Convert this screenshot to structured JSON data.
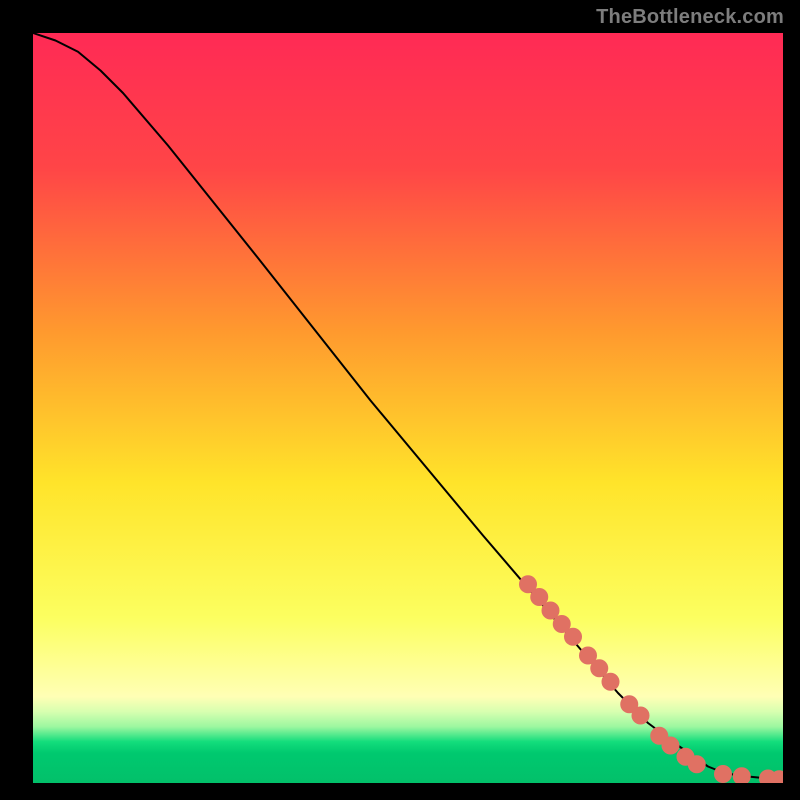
{
  "watermark": "TheBottleneck.com",
  "chart_data": {
    "type": "line",
    "title": "",
    "xlabel": "",
    "ylabel": "",
    "xlim": [
      0,
      100
    ],
    "ylim": [
      0,
      100
    ],
    "grid": false,
    "background_gradient": {
      "stops": [
        {
          "y": 0,
          "color": "#ff2a55"
        },
        {
          "y": 0.18,
          "color": "#ff4547"
        },
        {
          "y": 0.4,
          "color": "#ff9a2e"
        },
        {
          "y": 0.6,
          "color": "#ffe42a"
        },
        {
          "y": 0.78,
          "color": "#fcff60"
        },
        {
          "y": 0.885,
          "color": "#ffffb5"
        },
        {
          "y": 0.905,
          "color": "#d7ffb0"
        },
        {
          "y": 0.925,
          "color": "#9cf7a0"
        },
        {
          "y": 0.945,
          "color": "#13dd7c"
        },
        {
          "y": 0.96,
          "color": "#00c96f"
        },
        {
          "y": 1.0,
          "color": "#02c06a"
        }
      ]
    },
    "series": [
      {
        "name": "bottleneck-curve",
        "color": "#000000",
        "stroke_width": 2,
        "x": [
          0,
          3,
          6,
          9,
          12,
          18,
          30,
          45,
          60,
          72,
          78,
          82,
          86,
          90,
          92,
          94,
          96,
          98,
          100
        ],
        "y": [
          100,
          99,
          97.5,
          95,
          92,
          85,
          70,
          51,
          33,
          19,
          12,
          8,
          5,
          2.2,
          1.4,
          1.0,
          0.8,
          0.6,
          0.5
        ]
      }
    ],
    "markers": {
      "name": "selected-points",
      "color": "#e07163",
      "radius": 9,
      "points": [
        {
          "x": 66,
          "y": 26.5
        },
        {
          "x": 67.5,
          "y": 24.8
        },
        {
          "x": 69,
          "y": 23
        },
        {
          "x": 70.5,
          "y": 21.2
        },
        {
          "x": 72,
          "y": 19.5
        },
        {
          "x": 74,
          "y": 17
        },
        {
          "x": 75.5,
          "y": 15.3
        },
        {
          "x": 77,
          "y": 13.5
        },
        {
          "x": 79.5,
          "y": 10.5
        },
        {
          "x": 81,
          "y": 9
        },
        {
          "x": 83.5,
          "y": 6.3
        },
        {
          "x": 85,
          "y": 5
        },
        {
          "x": 87,
          "y": 3.5
        },
        {
          "x": 88.5,
          "y": 2.5
        },
        {
          "x": 92,
          "y": 1.2
        },
        {
          "x": 94.5,
          "y": 0.9
        },
        {
          "x": 98,
          "y": 0.6
        },
        {
          "x": 99.5,
          "y": 0.5
        }
      ]
    }
  }
}
